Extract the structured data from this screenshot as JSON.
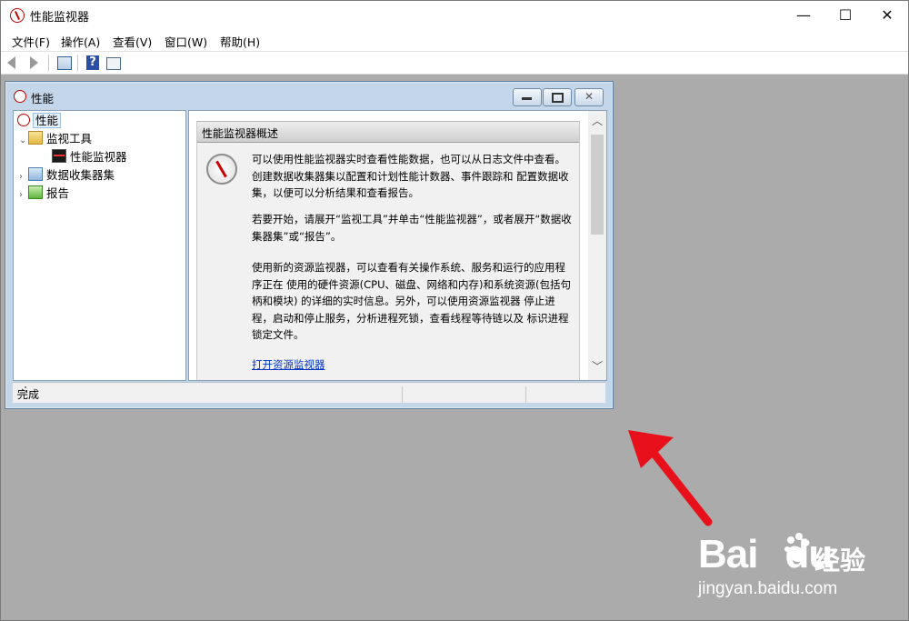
{
  "window": {
    "title": "性能监视器"
  },
  "window_controls": {
    "minimize": "—",
    "maximize": "☐",
    "close": "✕"
  },
  "menu": [
    "文件(F)",
    "操作(A)",
    "查看(V)",
    "窗口(W)",
    "帮助(H)"
  ],
  "toolbar": {
    "help_glyph": "?"
  },
  "child_window": {
    "title": "性能",
    "controls": {
      "minimize": "–",
      "restore": "▭",
      "close": "✕"
    }
  },
  "tree": {
    "root": "性能",
    "items": [
      {
        "label": "监视工具",
        "expanded": true
      },
      {
        "label": "性能监视器"
      },
      {
        "label": "数据收集器集",
        "expanded": false
      },
      {
        "label": "报告",
        "expanded": false
      }
    ]
  },
  "content": {
    "header": "性能监视器概述",
    "paragraphs": [
      "可以使用性能监视器实时查看性能数据，也可以从日志文件中查看。创建数据收集器集以配置和计划性能计数器、事件跟踪和 配置数据收集，以便可以分析结果和查看报告。",
      "若要开始，请展开“监视工具”并单击“性能监视器”，或者展开“数据收集器集”或“报告”。",
      "使用新的资源监视器，可以查看有关操作系统、服务和运行的应用程序正在 使用的硬件资源(CPU、磁盘、网络和内存)和系统资源(包括句柄和模块) 的详细的实时信息。另外，可以使用资源监视器 停止进程，启动和停止服务，分析进程死锁，查看线程等待链以及 标识进程锁定文件。"
    ],
    "link": "打开资源监视器"
  },
  "status": {
    "text": "完成"
  },
  "scroll": {
    "up": "︿",
    "down": "﹀"
  },
  "colors": {
    "annotation_arrow": "#e8101a",
    "mdi_background": "#ababab"
  },
  "watermark": {
    "brand": "Bai",
    "brand2": "du",
    "cn": "经验",
    "url": "jingyan.baidu.com"
  }
}
